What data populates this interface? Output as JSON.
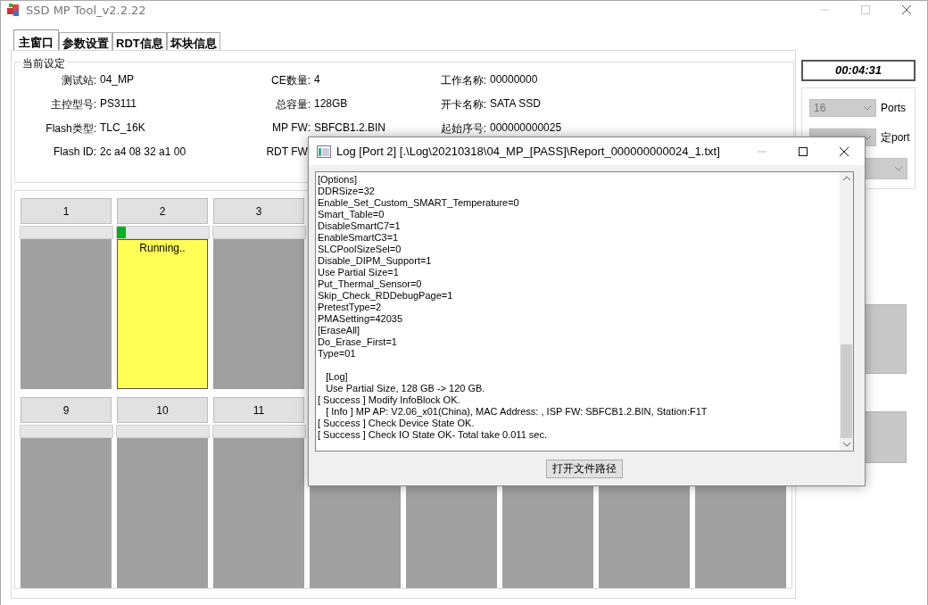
{
  "window": {
    "title": "SSD MP Tool_v2.2.22"
  },
  "tabs": [
    {
      "label": "主窗口",
      "selected": true
    },
    {
      "label": "参数设置",
      "selected": false
    },
    {
      "label": "RDT信息",
      "selected": false
    },
    {
      "label": "坏块信息",
      "selected": false
    }
  ],
  "settings": {
    "title": "当前设定",
    "fields": [
      {
        "label": "测试站:",
        "value": "04_MP"
      },
      {
        "label": "CE数量:",
        "value": "4"
      },
      {
        "label": "工作名称:",
        "value": "00000000"
      },
      {
        "label": "主控型号:",
        "value": "PS3111"
      },
      {
        "label": "总容量:",
        "value": "128GB"
      },
      {
        "label": "开卡名称:",
        "value": "SATA SSD"
      },
      {
        "label": "Flash类型:",
        "value": "TLC_16K"
      },
      {
        "label": "MP FW:",
        "value": "SBFCB1.2.BIN"
      },
      {
        "label": "起始序号:",
        "value": "000000000025"
      },
      {
        "label": "Flash ID:",
        "value": "2c a4 08 32 a1 00"
      },
      {
        "label": "RDT FW:"
      }
    ]
  },
  "port_rows": [
    {
      "ports": [
        {
          "label": "1",
          "running": false
        },
        {
          "label": "2",
          "running": true,
          "level": 0.1,
          "status": "Running.."
        },
        {
          "label": "3",
          "running": false
        }
      ]
    },
    {
      "ports": [
        {
          "label": "9",
          "running": false
        },
        {
          "label": "10",
          "running": false
        },
        {
          "label": "11",
          "running": false
        },
        {
          "running": false
        },
        {
          "running": false
        },
        {
          "running": false
        },
        {
          "running": false
        },
        {
          "running": false
        }
      ]
    }
  ],
  "timer": "00:04:31",
  "options": [
    {
      "value": "16",
      "label": "Ports",
      "disabled": true
    },
    {
      "label": "定port",
      "disabled": true
    },
    {
      "disabled": true
    }
  ],
  "log_dialog": {
    "title": "Log [Port 2] [.\\Log\\20210318\\04_MP_[PASS]\\Report_000000000024_1.txt]",
    "text": "[Options]\nDDRSize=32\nEnable_Set_Custom_SMART_Temperature=0\nSmart_Table=0\nDisableSmartC7=1\nEnableSmartC3=1\nSLCPoolSizeSel=0\nDisable_DIPM_Support=1\nUse Partial Size=1\nPut_Thermal_Sensor=0\nSkip_Check_RDDebugPage=1\nPretestType=2\nPMASetting=42035\n[EraseAll]\nDo_Erase_First=1\nType=01\n\n   [Log]\n   Use Partial Size, 128 GB -> 120 GB.\n[ Success ] Modify InfoBlock OK.\n   [ Info ] MP AP: V2.06_x01(China), MAC Address: , ISP FW: SBFCB1.2.BIN, Station:F1T\n[ Success ] Check Device State OK.\n[ Success ] Check IO State OK- Total take 0.011 sec.",
    "button": "打开文件路径"
  }
}
